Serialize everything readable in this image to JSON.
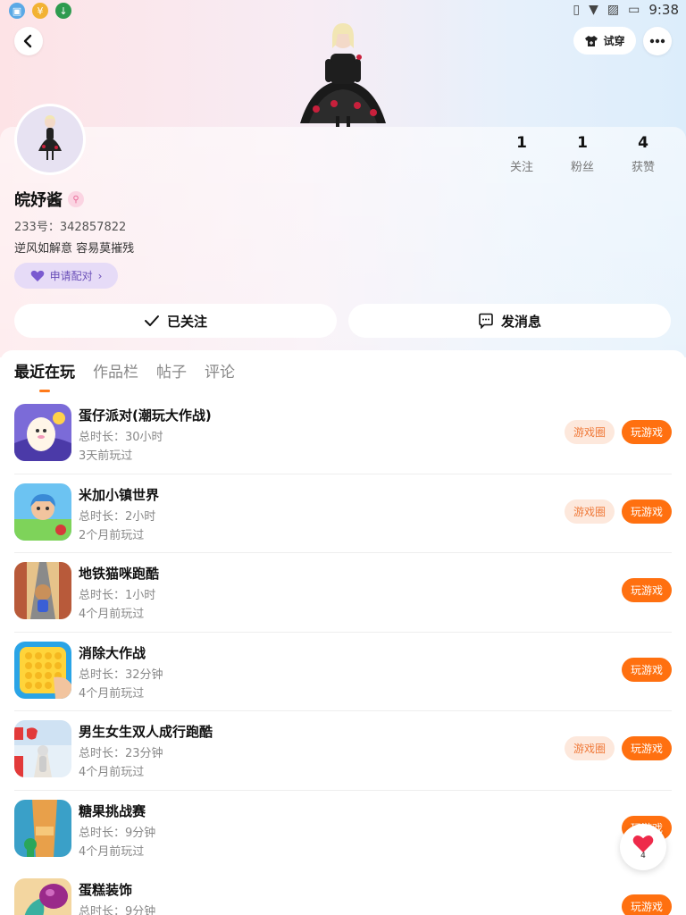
{
  "status_bar": {
    "time": "9:38",
    "left_icons": [
      "store-icon",
      "coin-icon",
      "download-icon"
    ],
    "right_icons": [
      "vibrate-icon",
      "wifi-icon",
      "no-sim-icon",
      "battery-icon"
    ]
  },
  "header": {
    "back_icon": "back-arrow-icon",
    "try_on_label": "试穿",
    "more_icon": "more-icon"
  },
  "profile": {
    "name": "皖妤酱",
    "uid": "233号：342857822",
    "bio": "逆风如解意 容易莫摧残",
    "pair_label": "申请配对",
    "stats": [
      {
        "value": "1",
        "label": "关注"
      },
      {
        "value": "1",
        "label": "粉丝"
      },
      {
        "value": "4",
        "label": "获赞"
      }
    ]
  },
  "actions": {
    "followed_label": "已关注",
    "message_label": "发消息"
  },
  "tabs": [
    {
      "label": "最近在玩",
      "active": true
    },
    {
      "label": "作品栏",
      "active": false
    },
    {
      "label": "帖子",
      "active": false
    },
    {
      "label": "评论",
      "active": false
    }
  ],
  "games": [
    {
      "title": "蛋仔派对(潮玩大作战)",
      "duration": "总时长：30小时",
      "last_played": "3天前玩过",
      "has_circle": true,
      "icon": "egg-party-icon"
    },
    {
      "title": "米加小镇世界",
      "duration": "总时长：2小时",
      "last_played": "2个月前玩过",
      "has_circle": true,
      "icon": "miga-town-icon"
    },
    {
      "title": "地铁猫咪跑酷",
      "duration": "总时长：1小时",
      "last_played": "4个月前玩过",
      "has_circle": false,
      "icon": "subway-cat-icon"
    },
    {
      "title": "消除大作战",
      "duration": "总时长：32分钟",
      "last_played": "4个月前玩过",
      "has_circle": false,
      "icon": "pop-it-icon"
    },
    {
      "title": "男生女生双人成行跑酷",
      "duration": "总时长：23分钟",
      "last_played": "4个月前玩过",
      "has_circle": true,
      "icon": "boy-girl-run-icon"
    },
    {
      "title": "糖果挑战赛",
      "duration": "总时长：9分钟",
      "last_played": "4个月前玩过",
      "has_circle": false,
      "icon": "candy-challenge-icon"
    },
    {
      "title": "蛋糕装饰",
      "duration": "总时长：9分钟",
      "last_played": "",
      "has_circle": false,
      "icon": "cake-decor-icon"
    }
  ],
  "buttons": {
    "circle_label": "游戏圈",
    "play_label": "玩游戏"
  },
  "floating": {
    "like_count": "4"
  },
  "colors": {
    "accent": "#ff7010",
    "circle_bg": "#fde8dc",
    "pair_bg": "#e6dbf7"
  }
}
